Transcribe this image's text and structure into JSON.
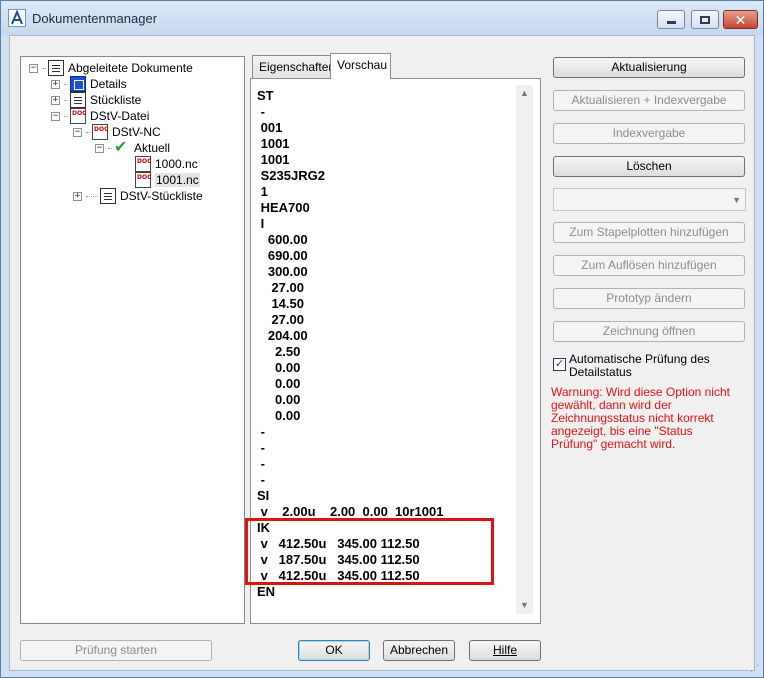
{
  "window": {
    "title": "Dokumentenmanager"
  },
  "tree": {
    "root": "Abgeleitete Dokumente",
    "details": "Details",
    "stueckliste": "Stückliste",
    "dstv_datei": "DStV-Datei",
    "dstv_nc": "DStV-NC",
    "aktuell": "Aktuell",
    "file1": "1000.nc",
    "file2": "1001.nc",
    "dstv_stueckliste": "DStV-Stückliste"
  },
  "tabs": {
    "eigenschaften": "Eigenschaften",
    "vorschau": "Vorschau"
  },
  "preview_lines": [
    "ST",
    " -",
    " 001",
    " 1001",
    " 1001",
    " S235JRG2",
    " 1",
    " HEA700",
    " I",
    "   600.00",
    "   690.00",
    "   300.00",
    "    27.00",
    "    14.50",
    "    27.00",
    "   204.00",
    "     2.50",
    "     0.00",
    "     0.00",
    "     0.00",
    "     0.00",
    " -",
    " -",
    " -",
    " -",
    "SI",
    " v    2.00u    2.00  0.00  10r1001",
    "IK",
    " v   412.50u   345.00 112.50",
    " v   187.50u   345.00 112.50",
    " v   412.50u   345.00 112.50",
    "EN"
  ],
  "buttons": {
    "aktualisierung": "Aktualisierung",
    "aktualisieren_index": "Aktualisieren + Indexvergabe",
    "indexvergabe": "Indexvergabe",
    "loeschen": "Löschen",
    "stapelplotten": "Zum Stapelplotten hinzufügen",
    "aufloesen": "Zum Auflösen hinzufügen",
    "prototyp": "Prototyp ändern",
    "zeichnung": "Zeichnung öffnen",
    "pruefung_starten": "Prüfung starten",
    "ok": "OK",
    "abbrechen": "Abbrechen",
    "hilfe": "Hilfe"
  },
  "checkbox": {
    "label": "Automatische Prüfung des Detailstatus",
    "checked": true
  },
  "warning": "Warnung: Wird diese Option nicht gewählt, dann wird der Zeichnungsstatus nicht korrekt angezeigt, bis eine \"Status Prüfung\" gemacht wird."
}
